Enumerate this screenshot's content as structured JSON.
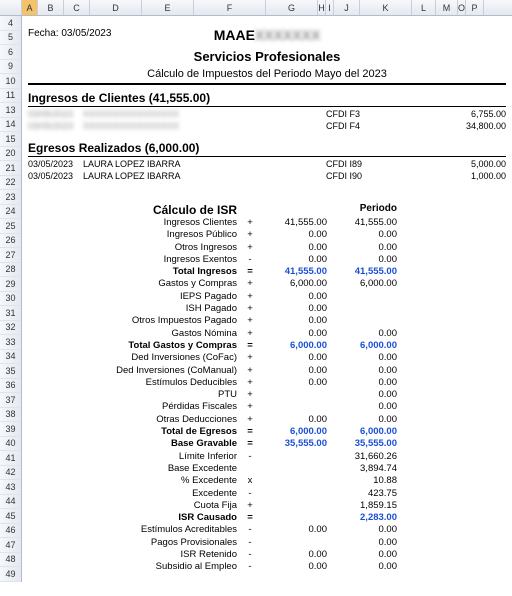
{
  "cols": [
    {
      "l": "",
      "w": 22,
      "sel": false
    },
    {
      "l": "A",
      "w": 16,
      "sel": true
    },
    {
      "l": "B",
      "w": 26,
      "sel": false
    },
    {
      "l": "C",
      "w": 26,
      "sel": false
    },
    {
      "l": "D",
      "w": 52,
      "sel": false
    },
    {
      "l": "E",
      "w": 52,
      "sel": false
    },
    {
      "l": "F",
      "w": 72,
      "sel": false
    },
    {
      "l": "G",
      "w": 52,
      "sel": false
    },
    {
      "l": "H",
      "w": 8,
      "sel": false
    },
    {
      "l": "I",
      "w": 8,
      "sel": false
    },
    {
      "l": "J",
      "w": 26,
      "sel": false
    },
    {
      "l": "K",
      "w": 52,
      "sel": false
    },
    {
      "l": "L",
      "w": 24,
      "sel": false
    },
    {
      "l": "M",
      "w": 22,
      "sel": false
    },
    {
      "l": "O",
      "w": 8,
      "sel": false
    },
    {
      "l": "P",
      "w": 18,
      "sel": false
    }
  ],
  "rows": [
    "4",
    "5",
    "6",
    "9",
    "10",
    "11",
    "13",
    "14",
    "15",
    "20",
    "21",
    "22",
    "23",
    "24",
    "25",
    "26",
    "27",
    "28",
    "29",
    "30",
    "31",
    "32",
    "33",
    "34",
    "35",
    "36",
    "37",
    "38",
    "39",
    "40",
    "41",
    "42",
    "43",
    "44",
    "45",
    "46",
    "47",
    "48",
    "49"
  ],
  "fecha_label": "Fecha:",
  "fecha_value": "03/05/2023",
  "title1": "MAAE",
  "title2": "Servicios Profesionales",
  "title3": "Cálculo de Impuestos del Periodo Mayo del 2023",
  "ingresos_header": "Ingresos de Clientes (41,555.00)",
  "ingresos": [
    {
      "date": "03/05/2023",
      "name": "XXXXXXXXXXXXXXXX",
      "cfdi": "CFDI F3",
      "amt": "6,755.00"
    },
    {
      "date": "03/05/2023",
      "name": "XXXXXXXXXXXXXXXX",
      "cfdi": "CFDI F4",
      "amt": "34,800.00"
    }
  ],
  "egresos_header": "Egresos Realizados (6,000.00)",
  "egresos": [
    {
      "date": "03/05/2023",
      "name": "LAURA LOPEZ IBARRA",
      "cfdi": "CFDI I89",
      "amt": "5,000.00"
    },
    {
      "date": "03/05/2023",
      "name": "LAURA LOPEZ IBARRA",
      "cfdi": "CFDI I90",
      "amt": "1,000.00"
    }
  ],
  "calc_title": "Cálculo de ISR",
  "periodo_label": "Periodo",
  "calc": [
    {
      "label": "Ingresos Clientes",
      "op": "+",
      "c1": "41,555.00",
      "c2": "41,555.00"
    },
    {
      "label": "Ingresos Público",
      "op": "+",
      "c1": "0.00",
      "c2": "0.00"
    },
    {
      "label": "Otros Ingresos",
      "op": "+",
      "c1": "0.00",
      "c2": "0.00"
    },
    {
      "label": "Ingresos Exentos",
      "op": "-",
      "c1": "0.00",
      "c2": "0.00"
    },
    {
      "label": "Total Ingresos",
      "op": "=",
      "c1": "41,555.00",
      "c2": "41,555.00",
      "bold": true,
      "blue": true
    },
    {
      "label": "Gastos y Compras",
      "op": "+",
      "c1": "6,000.00",
      "c2": "6,000.00"
    },
    {
      "label": "IEPS Pagado",
      "op": "+",
      "c1": "0.00",
      "c2": ""
    },
    {
      "label": "ISH Pagado",
      "op": "+",
      "c1": "0.00",
      "c2": ""
    },
    {
      "label": "Otros Impuestos Pagado",
      "op": "+",
      "c1": "0.00",
      "c2": ""
    },
    {
      "label": "Gastos Nómina",
      "op": "+",
      "c1": "0.00",
      "c2": "0.00"
    },
    {
      "label": "Total Gastos y Compras",
      "op": "=",
      "c1": "6,000.00",
      "c2": "6,000.00",
      "bold": true,
      "blue": true
    },
    {
      "label": "Ded Inversiones (CoFac)",
      "op": "+",
      "c1": "0.00",
      "c2": "0.00"
    },
    {
      "label": "Ded Inversiones (CoManual)",
      "op": "+",
      "c1": "0.00",
      "c2": "0.00"
    },
    {
      "label": "Estímulos Deducibles",
      "op": "+",
      "c1": "0.00",
      "c2": "0.00"
    },
    {
      "label": "PTU",
      "op": "+",
      "c1": "",
      "c2": "0.00"
    },
    {
      "label": "Pérdidas Fiscales",
      "op": "+",
      "c1": "",
      "c2": "0.00"
    },
    {
      "label": "Otras Deducciones",
      "op": "+",
      "c1": "0.00",
      "c2": "0.00"
    },
    {
      "label": "Total de Egresos",
      "op": "=",
      "c1": "6,000.00",
      "c2": "6,000.00",
      "bold": true,
      "blue": true
    },
    {
      "label": "Base Gravable",
      "op": "=",
      "c1": "35,555.00",
      "c2": "35,555.00",
      "bold": true,
      "blue": true
    },
    {
      "label": "Límite Inferior",
      "op": "-",
      "c1": "",
      "c2": "31,660.26"
    },
    {
      "label": "Base Excedente",
      "op": "",
      "c1": "",
      "c2": "3,894.74"
    },
    {
      "label": "% Excedente",
      "op": "x",
      "c1": "",
      "c2": "10.88"
    },
    {
      "label": "Excedente",
      "op": "-",
      "c1": "",
      "c2": "423.75"
    },
    {
      "label": "Cuota Fija",
      "op": "+",
      "c1": "",
      "c2": "1,859.15"
    },
    {
      "label": "ISR Causado",
      "op": "=",
      "c1": "",
      "c2": "2,283.00",
      "bold": true,
      "blue2": true
    },
    {
      "label": "Estímulos Acreditables",
      "op": "-",
      "c1": "0.00",
      "c2": "0.00"
    },
    {
      "label": "Pagos Provisionales",
      "op": "-",
      "c1": "",
      "c2": "0.00"
    },
    {
      "label": "ISR Retenido",
      "op": "-",
      "c1": "0.00",
      "c2": "0.00"
    },
    {
      "label": "Subsidio al Empleo",
      "op": "-",
      "c1": "0.00",
      "c2": "0.00"
    }
  ]
}
